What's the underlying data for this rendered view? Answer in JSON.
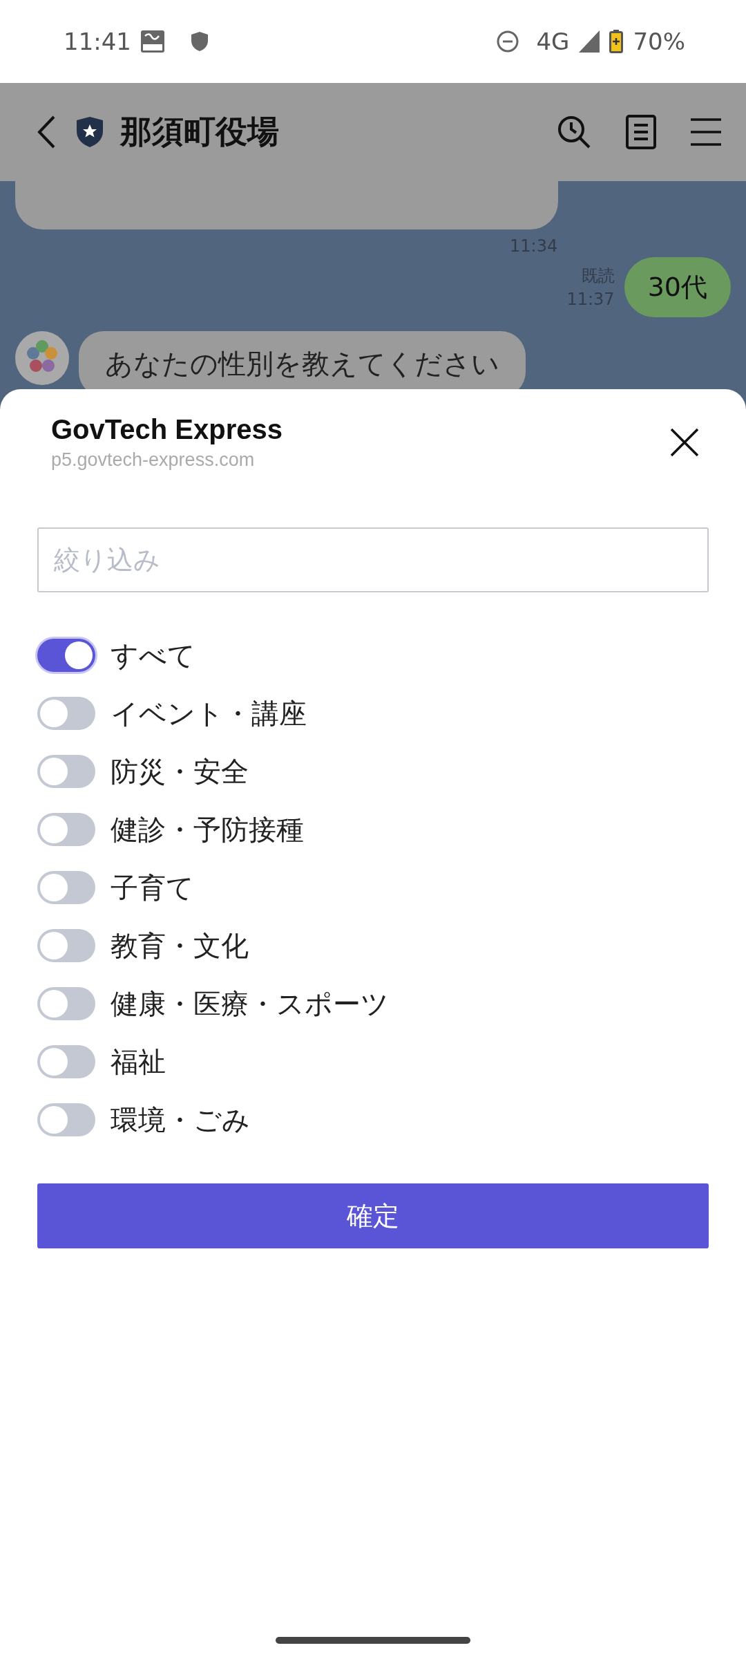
{
  "status_bar": {
    "time": "11:41",
    "network": "4G",
    "battery": "70%"
  },
  "header": {
    "title": "那須町役場"
  },
  "chat": {
    "messages": [
      {
        "time": "11:34"
      },
      {
        "text": "30代",
        "read": "既読",
        "time": "11:37"
      },
      {
        "text": "あなたの性別を教えてください"
      }
    ]
  },
  "sheet": {
    "title": "GovTech Express",
    "url": "p5.govtech-express.com",
    "filter": {
      "placeholder": "絞り込み"
    },
    "options": [
      {
        "label": "すべて",
        "on": true
      },
      {
        "label": "イベント・講座",
        "on": false
      },
      {
        "label": "防災・安全",
        "on": false
      },
      {
        "label": "健診・予防接種",
        "on": false
      },
      {
        "label": "子育て",
        "on": false
      },
      {
        "label": "教育・文化",
        "on": false
      },
      {
        "label": "健康・医療・スポーツ",
        "on": false
      },
      {
        "label": "福祉",
        "on": false
      },
      {
        "label": "環境・ごみ",
        "on": false
      }
    ],
    "confirm": "確定"
  }
}
